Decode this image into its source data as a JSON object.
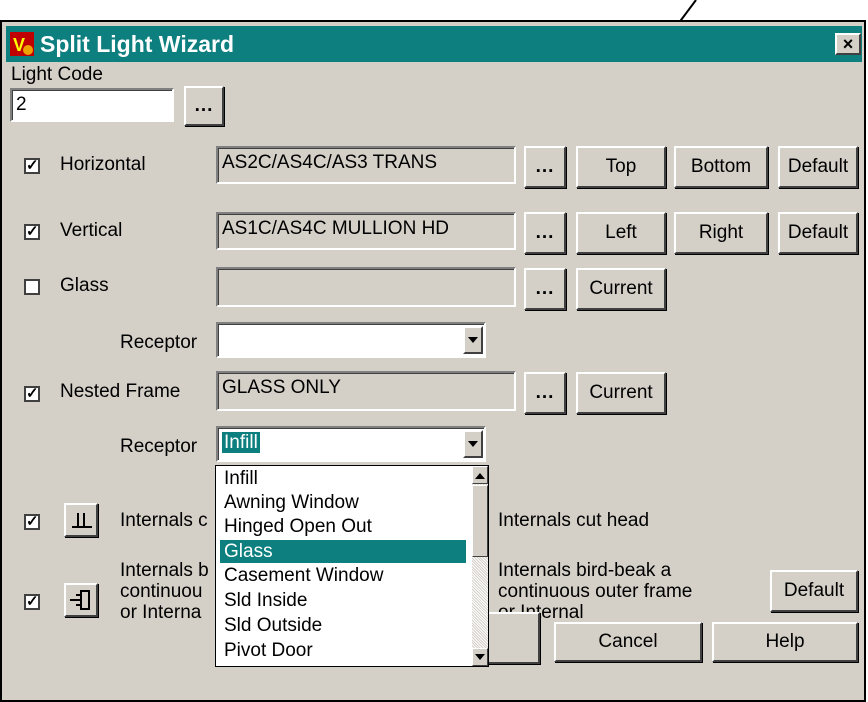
{
  "window": {
    "title": "Split Light Wizard",
    "close_label": "×",
    "accent_color": "#0e7f7f"
  },
  "light_code": {
    "label": "Light Code",
    "value": "2",
    "browse_label": "..."
  },
  "rows": {
    "horizontal": {
      "label": "Horizontal",
      "checked": true,
      "value": "AS2C/AS4C/AS3 TRANS",
      "browse_label": "...",
      "buttons": [
        "Top",
        "Bottom",
        "Default"
      ]
    },
    "vertical": {
      "label": "Vertical",
      "checked": true,
      "value": "AS1C/AS4C MULLION HD",
      "browse_label": "...",
      "buttons": [
        "Left",
        "Right",
        "Default"
      ]
    },
    "glass": {
      "label": "Glass",
      "checked": false,
      "value": "",
      "browse_label": "...",
      "button": "Current"
    },
    "glass_receptor": {
      "label": "Receptor",
      "value": ""
    },
    "nested_frame": {
      "label": "Nested Frame",
      "checked": true,
      "value": "GLASS ONLY",
      "browse_label": "...",
      "button": "Current"
    },
    "nested_receptor": {
      "label": "Receptor",
      "value": "Infill"
    }
  },
  "receptor_dropdown": {
    "options": [
      "Infill",
      "Awning Window",
      "Hinged Open Out",
      "Glass",
      "Casement Window",
      "Sld Inside",
      "Sld Outside",
      "Pivot Door"
    ],
    "highlighted": "Glass"
  },
  "internals": {
    "cut_sill_label_partial": "Internals c",
    "cut_head_label": "Internals cut head",
    "birdbeak_left_lines": [
      "Internals b",
      "continuou",
      "or Interna"
    ],
    "birdbeak_right_lines": [
      "Internals bird-beak a",
      "continuous outer frame",
      "or Internal"
    ],
    "default_label": "Default"
  },
  "footer": {
    "cancel_label": "Cancel",
    "help_label": "Help"
  }
}
